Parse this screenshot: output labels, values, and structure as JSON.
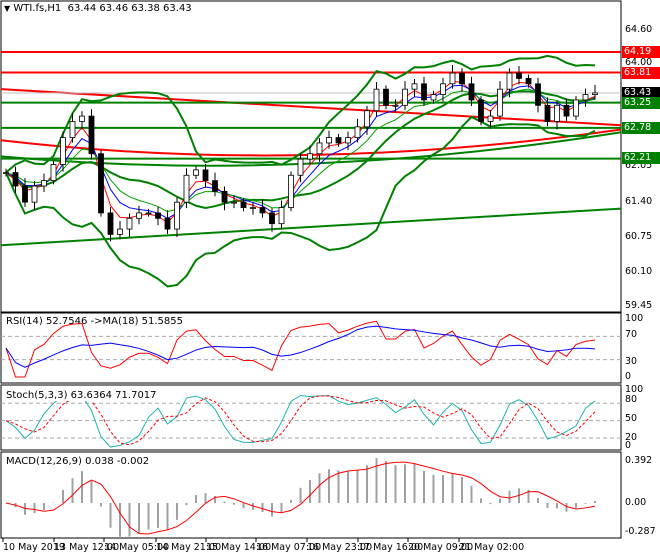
{
  "header": {
    "arrow": "▼",
    "symbol": "WTI.fs,H1",
    "ohlc": "63.44 63.46 63.38 63.43"
  },
  "colors": {
    "bull": "#ffffff",
    "bear": "#000000",
    "band": "#008000",
    "level_red": "#ff0000",
    "level_green": "#008000",
    "current": "#000000",
    "ma1": "#ff0000",
    "ma2": "#0000ff",
    "ma3": "#008000"
  },
  "chart_data": {
    "type": "candlestick",
    "symbol": "WTI.fs",
    "timeframe": "H1",
    "closes": [
      61.95,
      61.7,
      61.4,
      61.7,
      61.8,
      62.1,
      62.6,
      62.9,
      63.0,
      62.3,
      61.2,
      60.8,
      60.9,
      61.1,
      61.2,
      61.2,
      61.1,
      60.9,
      61.4,
      61.9,
      62.0,
      61.8,
      61.6,
      61.4,
      61.4,
      61.3,
      61.3,
      61.2,
      61.0,
      61.3,
      61.9,
      62.2,
      62.3,
      62.5,
      62.6,
      62.5,
      62.6,
      62.8,
      63.1,
      63.5,
      63.2,
      63.2,
      63.5,
      63.6,
      63.3,
      63.4,
      63.6,
      63.8,
      63.6,
      63.3,
      62.9,
      63.0,
      63.5,
      63.8,
      63.7,
      63.6,
      63.2,
      62.9,
      63.2,
      63.0,
      63.3,
      63.4,
      63.43
    ],
    "price_axis": {
      "ticks": [
        "64.60",
        "64.00",
        "62.05",
        "61.40",
        "60.75",
        "60.10",
        "59.45"
      ],
      "range": [
        59.45,
        64.6
      ]
    },
    "levels": [
      {
        "price": 64.19,
        "label": "64.19",
        "color": "#ff0000"
      },
      {
        "price": 63.81,
        "label": "63.81",
        "color": "#ff0000"
      },
      {
        "price": 63.43,
        "label": "63.43",
        "color": "#000000"
      },
      {
        "price": 63.25,
        "label": "63.25",
        "color": "#008000"
      },
      {
        "price": 62.78,
        "label": "62.78",
        "color": "#008000"
      },
      {
        "price": 62.21,
        "label": "62.21",
        "color": "#008000"
      }
    ],
    "trendlines": [
      {
        "color": "#ff0000",
        "from": 63.5,
        "to": 62.83
      },
      {
        "color": "#008000",
        "from": 60.6,
        "to": 61.28
      }
    ],
    "time_axis": [
      "10 May 2019",
      "13 May 12:00",
      "14 May 05:00",
      "14 May 21:00",
      "15 May 14:00",
      "16 May 07:00",
      "16 May 23:00",
      "17 May 16:00",
      "20 May 09:00",
      "21 May 02:00"
    ],
    "rsi": {
      "label": "RSI(14) 52.7546  ->MA(18) 51.5855",
      "ticks": [
        "100",
        "70",
        "30",
        "0"
      ],
      "levels": [
        70,
        30
      ]
    },
    "stoch": {
      "label": "Stoch(5,3,3) 63.6364 71.7017",
      "ticks": [
        "100",
        "80",
        "50",
        "20",
        "0"
      ],
      "levels": [
        80,
        50,
        20
      ]
    },
    "macd": {
      "label": "MACD(12,26,9) 0.038 -0.002",
      "ticks": [
        "0.392",
        "0.00",
        "-0.287"
      ],
      "range": [
        -0.287,
        0.392
      ]
    }
  }
}
